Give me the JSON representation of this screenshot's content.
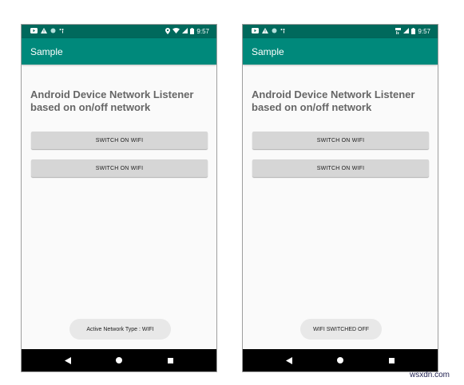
{
  "colors": {
    "status_bar": "#00695c",
    "app_bar": "#00897b",
    "button_bg": "#d6d6d6",
    "toast_bg": "#e8e8e8"
  },
  "phones": [
    {
      "status_bar": {
        "time": "9:57",
        "icons_left": [
          "youtube-icon",
          "warning-icon",
          "circle-icon",
          "signal-dots-icon"
        ],
        "icons_right": [
          "location-icon",
          "wifi-icon",
          "cell-signal-icon",
          "battery-icon"
        ]
      },
      "app_bar": {
        "title": "Sample"
      },
      "heading": "Android Device Network Listener based on on/off network",
      "buttons": [
        "SWITCH ON WIFI",
        "SWITCH ON WIFI"
      ],
      "toast": "Active Network Type : WIFI",
      "nav": [
        "back-icon",
        "home-icon",
        "recents-icon"
      ]
    },
    {
      "status_bar": {
        "time": "9:57",
        "icons_left": [
          "youtube-icon",
          "warning-icon",
          "circle-icon",
          "signal-dots-icon"
        ],
        "icons_right": [
          "lte-icon",
          "cell-signal-icon",
          "battery-icon"
        ]
      },
      "app_bar": {
        "title": "Sample"
      },
      "heading": "Android Device Network Listener based on on/off network",
      "buttons": [
        "SWITCH ON WIFI",
        "SWITCH ON WIFI"
      ],
      "toast": "WIFI SWITCHED OFF",
      "nav": [
        "back-icon",
        "home-icon",
        "recents-icon"
      ]
    }
  ],
  "watermark": "wsxdn.com"
}
